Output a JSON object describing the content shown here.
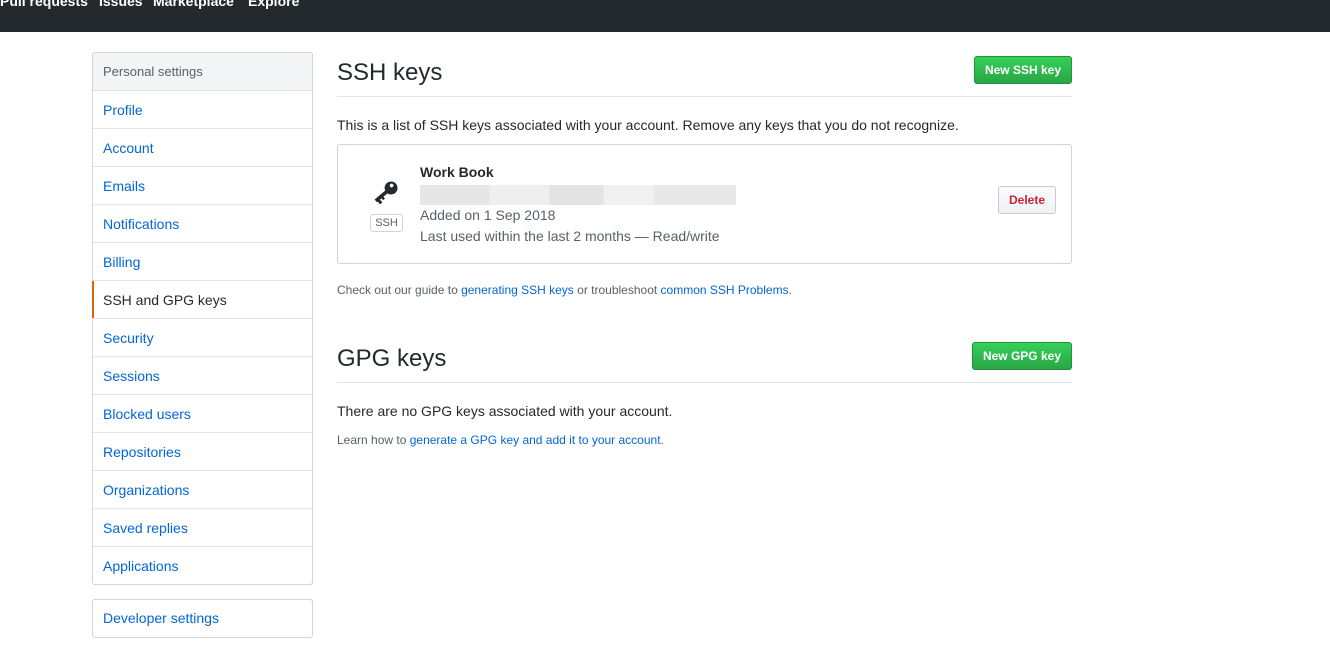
{
  "topnav": {
    "items": [
      "Pull requests",
      "Issues",
      "Marketplace",
      "Explore"
    ]
  },
  "sidebar": {
    "header": "Personal settings",
    "items": [
      {
        "label": "Profile"
      },
      {
        "label": "Account"
      },
      {
        "label": "Emails"
      },
      {
        "label": "Notifications"
      },
      {
        "label": "Billing"
      },
      {
        "label": "SSH and GPG keys",
        "selected": true
      },
      {
        "label": "Security"
      },
      {
        "label": "Sessions"
      },
      {
        "label": "Blocked users"
      },
      {
        "label": "Repositories"
      },
      {
        "label": "Organizations"
      },
      {
        "label": "Saved replies"
      },
      {
        "label": "Applications"
      }
    ],
    "developer_settings": "Developer settings"
  },
  "ssh": {
    "title": "SSH keys",
    "new_button": "New SSH key",
    "intro": "This is a list of SSH keys associated with your account. Remove any keys that you do not recognize.",
    "key": {
      "name": "Work Book",
      "badge": "SSH",
      "added": "Added on 1 Sep 2018",
      "last_used": "Last used within the last 2 months — Read/write",
      "delete_label": "Delete",
      "icon": "key-icon"
    },
    "guide": {
      "prefix": "Check out our guide to ",
      "link1": "generating SSH keys",
      "middle": " or troubleshoot ",
      "link2": "common SSH Problems",
      "suffix": "."
    }
  },
  "gpg": {
    "title": "GPG keys",
    "new_button": "New GPG key",
    "empty": "There are no GPG keys associated with your account.",
    "learn": {
      "prefix": "Learn how to ",
      "link": "generate a GPG key and add it to your account",
      "suffix": "."
    }
  },
  "colors": {
    "topbar": "#24292e",
    "link": "#0366d6",
    "green": "#28a745",
    "danger": "#cb2431",
    "selected_marker": "#e36209"
  }
}
